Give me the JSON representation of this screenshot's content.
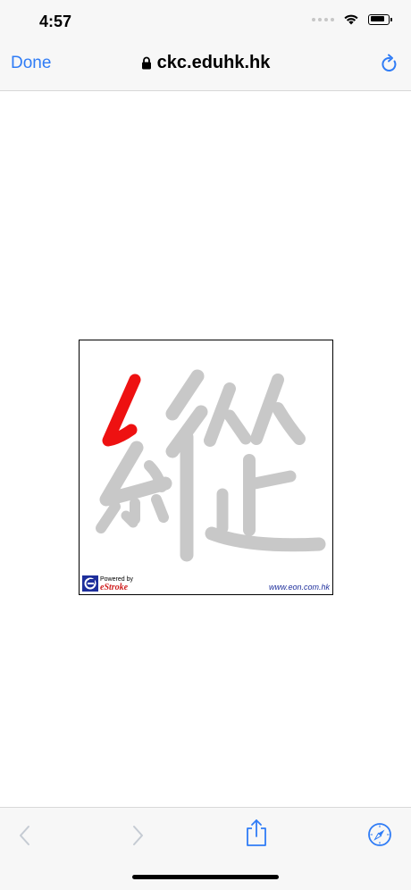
{
  "status_bar": {
    "time": "4:57"
  },
  "nav": {
    "done_label": "Done",
    "url": "ckc.eduhk.hk"
  },
  "stroke_widget": {
    "character": "縱",
    "powered_by": "Powered by",
    "brand": "eStroke",
    "site": "www.eon.com.hk"
  },
  "colors": {
    "accent": "#2f7cf6",
    "stroke_active": "#ee1111",
    "stroke_inactive": "#c8c8c8"
  },
  "icons": {
    "lock": "lock-icon",
    "reload": "reload-icon",
    "back": "chevron-left-icon",
    "forward": "chevron-right-icon",
    "share": "share-icon",
    "safari": "compass-icon"
  }
}
